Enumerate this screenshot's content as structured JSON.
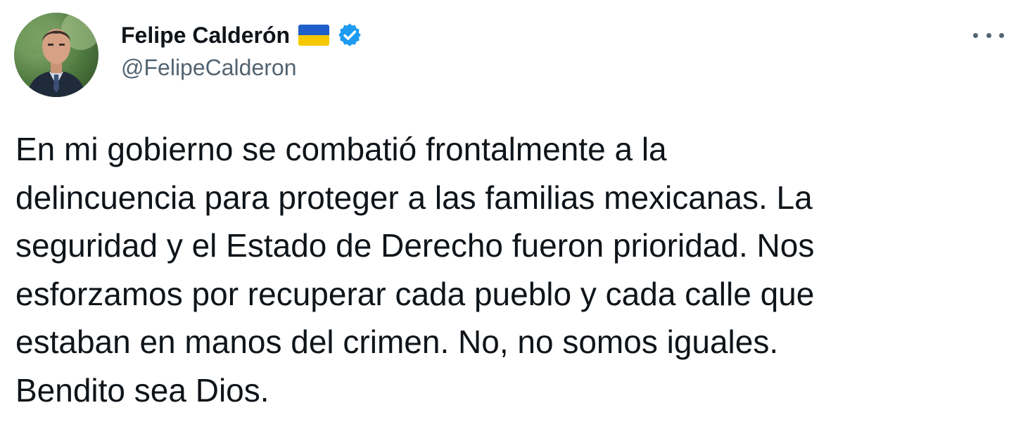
{
  "author": {
    "name": "Felipe Calderón",
    "handle": "@FelipeCalderon",
    "flag_icon": "ukraine-flag",
    "verified_icon": "verified-badge",
    "verified_color": "#1d9bf0"
  },
  "menu": {
    "icon": "more-options-icon"
  },
  "tweet": {
    "text": "En mi gobierno se combatió frontalmente a la\ndelincuencia para proteger a las familias mexicanas. La\nseguridad y el Estado de Derecho fueron prioridad. Nos\nesforzamos por recuperar cada pueblo y cada calle que\nestaban en manos del crimen. No, no somos iguales.\nBendito sea Dios."
  },
  "colors": {
    "background": "#ffffff",
    "text": "#0f1419",
    "secondary_text": "#536471",
    "flag_blue": "#1f5fc9",
    "flag_yellow": "#f6c800"
  }
}
